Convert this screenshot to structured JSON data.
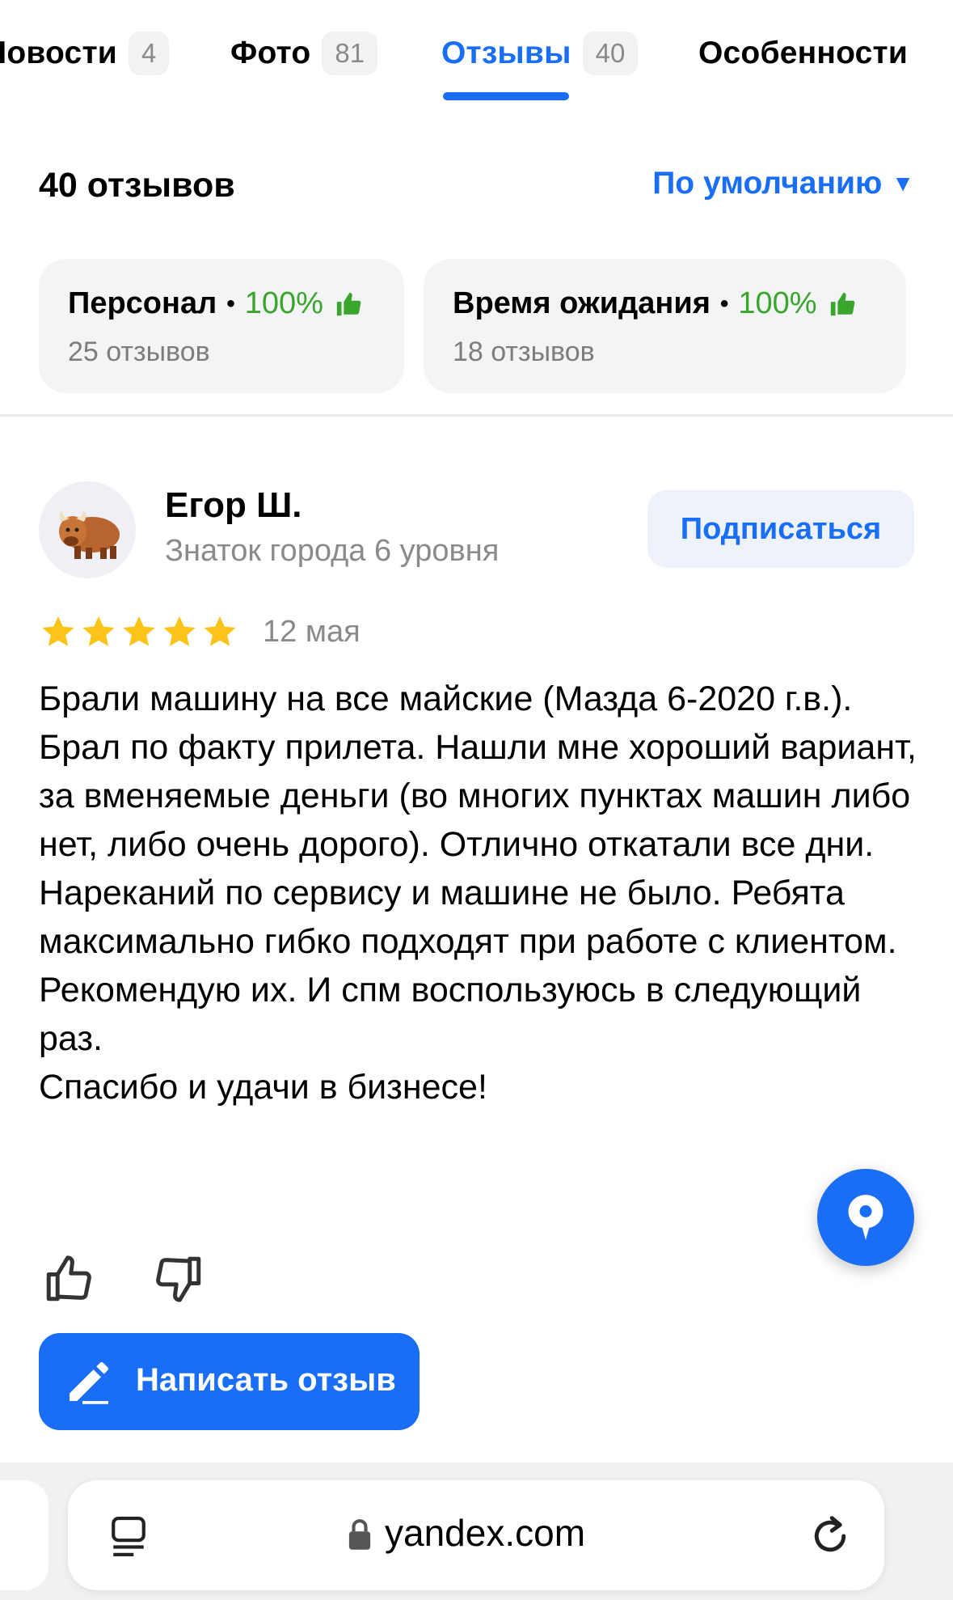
{
  "tabs": [
    {
      "label": "Новости",
      "count": "4"
    },
    {
      "label": "Фото",
      "count": "81"
    },
    {
      "label": "Отзывы",
      "count": "40"
    },
    {
      "label": "Особенности"
    }
  ],
  "reviews_header": {
    "title": "40 отзывов",
    "sort_label": "По умолчанию",
    "sort_caret": "▼"
  },
  "aspects": [
    {
      "name": "Персонал",
      "dot": "•",
      "percent": "100%",
      "reviews": "25 отзывов"
    },
    {
      "name": "Время ожидания",
      "dot": "•",
      "percent": "100%",
      "reviews": "18 отзывов"
    }
  ],
  "review": {
    "author": "Егор Ш.",
    "level": "Знаток города 6 уровня",
    "subscribe_label": "Подписаться",
    "rating": 5,
    "date": "12 мая",
    "paragraphs": [
      "Брали машину на все майские (Мазда 6-2020 г.в.). Брал по факту прилета. Нашли мне хороший вариант, за вменяемые деньги (во многих пунктах машин либо нет, либо очень дорого). Отлично откатали все дни. Нареканий по сервису и машине не было. Ребята максимально гибко подходят при работе с клиентом.",
      "Рекомендую их. И спм воспользуюсь в следующий раз.",
      "Спасибо и удачи в бизнесе!"
    ]
  },
  "write_review_label": "Написать отзыв",
  "browser": {
    "url": "yandex.com"
  },
  "colors": {
    "accent": "#1a6ef5",
    "positive": "#3aa52c",
    "star": "#fcc419"
  },
  "icons": [
    "thumb-up-icon",
    "thumb-down-icon",
    "pencil-icon",
    "map-pin-icon",
    "lock-icon",
    "reader-icon",
    "reload-icon",
    "star-icon"
  ]
}
